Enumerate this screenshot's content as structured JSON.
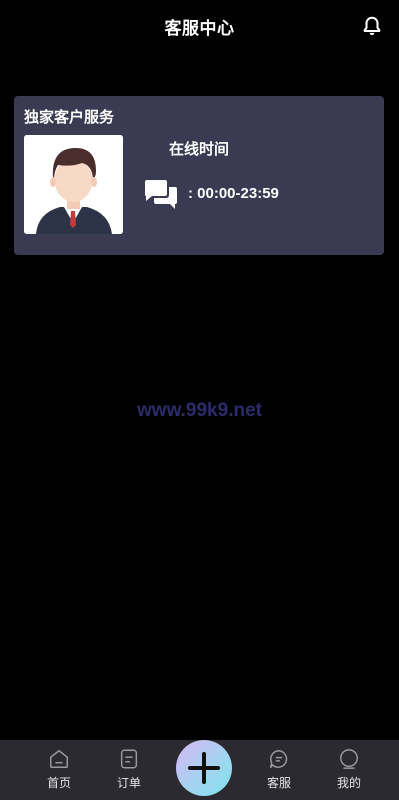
{
  "header": {
    "title": "客服中心",
    "bell_icon": "bell-icon"
  },
  "card": {
    "title": "独家客户服务",
    "online_label": "在线时间",
    "hours": ": 00:00-23:59",
    "avatar_icon": "avatar",
    "chat_icon": "chat-bubbles-icon"
  },
  "watermark": "www.99k9.net",
  "tabbar": {
    "tabs": [
      {
        "label": "首页",
        "icon": "home-icon"
      },
      {
        "label": "订单",
        "icon": "order-icon"
      },
      {
        "label": "客服",
        "icon": "chat-icon"
      },
      {
        "label": "我的",
        "icon": "profile-icon"
      }
    ],
    "fab_icon": "plus-icon"
  },
  "colors": {
    "card_bg": "#3a3a52",
    "tabbar_bg": "#2a2a30",
    "watermark": "#2c2c6a"
  }
}
